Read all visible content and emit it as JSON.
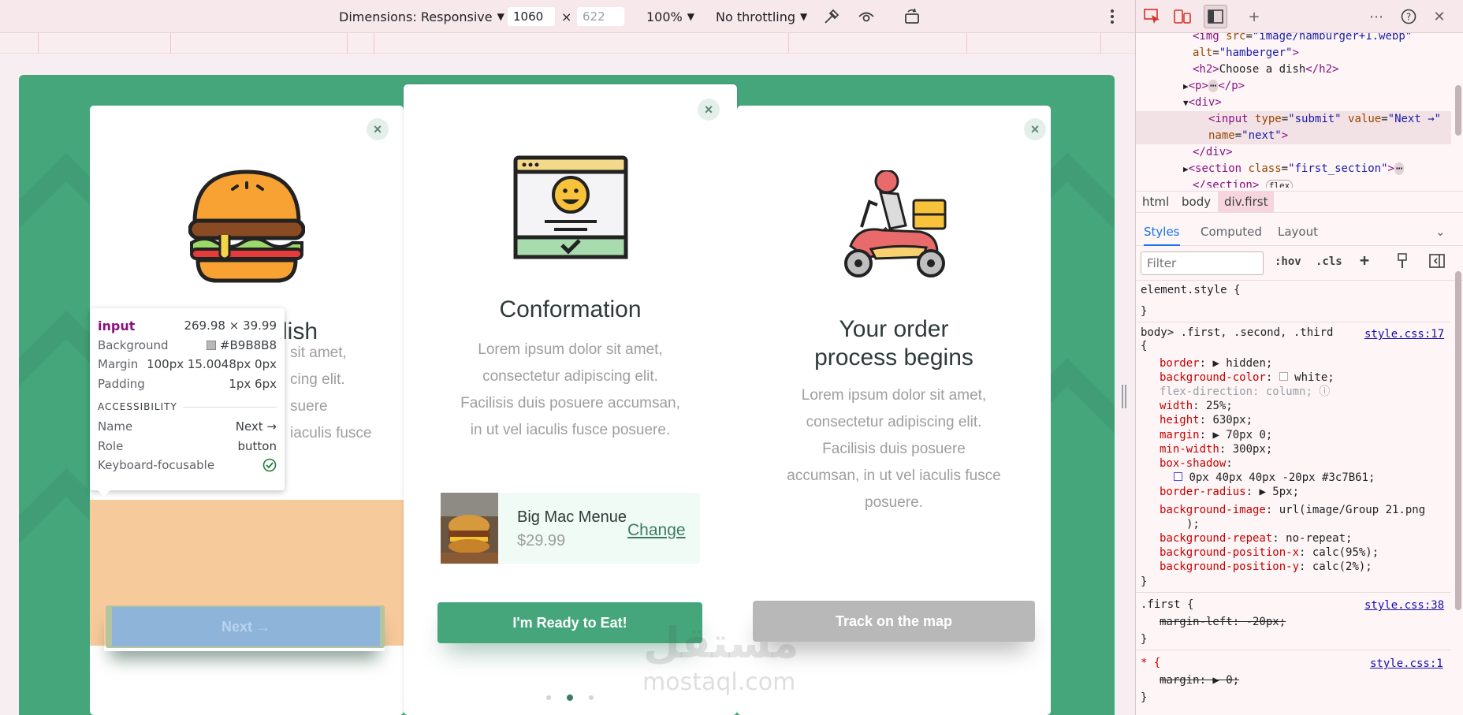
{
  "device_toolbar": {
    "dimensions_label": "Dimensions: Responsive",
    "width": "1060",
    "height": "622",
    "times": "×",
    "zoom": "100%",
    "throttling": "No throttling"
  },
  "cards": {
    "first": {
      "title": "Choose a dish",
      "title_visible": "dish",
      "text_visible": [
        "sit amet,",
        "cing elit.",
        "suere",
        "iaculis fusce"
      ],
      "next_label": "Next →"
    },
    "second": {
      "title": "Conformation",
      "text": [
        "Lorem ipsum dolor sit amet,",
        "consectetur adipiscing elit.",
        "Facilisis duis posuere accumsan,",
        "in ut vel iaculis fusce posuere."
      ],
      "order": {
        "name": "Big Mac Menue",
        "price": "$29.99",
        "change_label": "Change"
      },
      "button_label": "I'm Ready to Eat!"
    },
    "third": {
      "title_line1": "Your order",
      "title_line2": "process begins",
      "text": [
        "Lorem ipsum dolor sit amet,",
        "consectetur adipiscing elit.",
        "Facilisis duis posuere",
        "accumsan, in ut vel iaculis fusce",
        "posuere."
      ],
      "button_label": "Track on the map"
    }
  },
  "watermark": {
    "arabic": "مستقل",
    "latin": "mostaql.com"
  },
  "tooltip": {
    "element": "input",
    "size": "269.98 × 39.99",
    "background_label": "Background",
    "background_value": "#B9B8B8",
    "margin_label": "Margin",
    "margin_value": "100px 15.0048px 0px",
    "padding_label": "Padding",
    "padding_value": "1px 6px",
    "accessibility_label": "ACCESSIBILITY",
    "name_label": "Name",
    "name_value": "Next →",
    "role_label": "Role",
    "role_value": "button",
    "focusable_label": "Keyboard-focusable"
  },
  "devtools": {
    "dom_lines": {
      "img_src_attr": "src",
      "img_src": "\"image/hamburger+1.webp\"",
      "img_alt_attr": "alt",
      "img_alt": "\"hamberger\"",
      "h2_text": "Choose a dish",
      "input_type": "\"submit\"",
      "input_value": "\"Next →\"",
      "input_name": "\"next\"",
      "section_class": "\"first_section\"",
      "flex_badge": "flex"
    },
    "breadcrumbs": [
      "html",
      "body",
      "div.first"
    ],
    "tabs": [
      "Styles",
      "Computed",
      "Layout"
    ],
    "filter_placeholder": "Filter",
    "filter_buttons": [
      ":hov",
      ".cls"
    ],
    "rules": {
      "element_style": "element.style {",
      "rule1_selector": "body> .first, .second, .third",
      "rule1_source": "style.css:17",
      "rule1_props": [
        {
          "name": "border",
          "value": "▶ hidden;"
        },
        {
          "name": "background-color",
          "value": "white;"
        },
        {
          "name": "flex-direction",
          "value": "column;"
        },
        {
          "name": "width",
          "value": "25%;"
        },
        {
          "name": "height",
          "value": "630px;"
        },
        {
          "name": "margin",
          "value": "▶ 70px 0;"
        },
        {
          "name": "min-width",
          "value": "300px;"
        },
        {
          "name": "box-shadow",
          "value": ""
        },
        {
          "name": "",
          "value": "0px 40px 40px -20px #3c7B61;"
        },
        {
          "name": "border-radius",
          "value": "▶ 5px;"
        },
        {
          "name": "background-image",
          "value": "url(image/Group 21.png"
        },
        {
          "name": "",
          "value": ");"
        },
        {
          "name": "background-repeat",
          "value": "no-repeat;"
        },
        {
          "name": "background-position-x",
          "value": "calc(95%);"
        },
        {
          "name": "background-position-y",
          "value": "calc(2%);"
        }
      ],
      "rule2_selector": ".first {",
      "rule2_source": "style.css:38",
      "rule2_prop": "margin-left: -20px;",
      "rule3_selector": "* {",
      "rule3_source": "style.css:1",
      "rule3_prop": "margin: ▶ 0;"
    }
  },
  "colors": {
    "page_green": "#45a67c",
    "accent_green": "#45a67c",
    "grey_button": "#b9b8b8",
    "peach": "#f7ca9b",
    "highlight_blue": "#8fb4d9"
  }
}
